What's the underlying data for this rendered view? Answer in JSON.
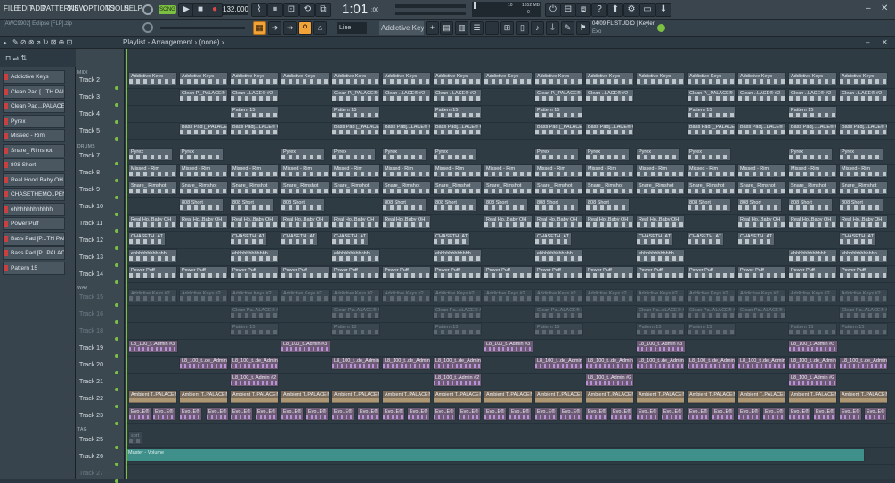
{
  "menu": [
    "FILE",
    "EDIT",
    "ADD",
    "PATTERNS",
    "VIEW",
    "OPTIONS",
    "TOOLS",
    "HELP"
  ],
  "transport": {
    "mode": "SONG",
    "tempo": "132.000",
    "time": "1:01",
    "time_sub": ":00",
    "cpu": "10",
    "mem": "1652 MB",
    "mem2": "0"
  },
  "hint": {
    "project": "[AWC9902] Eclipse [FLP].zip",
    "line": "04/09  FL STUDIO | Keyler",
    "sub": "Exo"
  },
  "toolbar": {
    "snap": "Line",
    "pattern": "Addictive Keys"
  },
  "playlist": {
    "title": "Playlist - Arrangement",
    "sub": "(none)"
  },
  "browser_patterns": [
    "Addictive Keys",
    "Clean Pad [...TH PALACE®",
    "Clean Pad...PALACE® #2",
    "Pyrex",
    "Missed - Rim",
    "Snare_ Rimshot",
    "808 Short",
    "Real Hood Baby OH",
    "CHASETHEMO..PEN HAT 1",
    "ehhhhhhhhhhhh",
    "Power Puff",
    "Bass Pad [P...TH PALACE®",
    "Bass Pad [P...PALACE® #2",
    "Pattern 15"
  ],
  "sections": {
    "midi": "MIDI",
    "drums": "DRUMS",
    "wav": "WAV",
    "fx": "FX",
    "tag": "TAG"
  },
  "tracks": [
    "Track 2",
    "Track 3",
    "Track 4",
    "Track 5",
    "Track 7",
    "Track 8",
    "Track 9",
    "Track 10",
    "Track 11",
    "Track 12",
    "Track 13",
    "Track 14",
    "Track 15",
    "Track 16",
    "Track 18",
    "Track 19",
    "Track 20",
    "Track 21",
    "Track 22",
    "Track 23",
    "Track 25",
    "Track 26",
    "Track 27"
  ],
  "ruler": [
    "3",
    "5",
    "9",
    "13",
    "17",
    "21",
    "25",
    "29",
    "33",
    "37",
    "41",
    "45",
    "49",
    "53",
    "57",
    "61",
    "65",
    "69",
    "73",
    "77",
    "81",
    "85",
    "89",
    "93",
    "97",
    "101",
    "105",
    "109",
    "113",
    "117"
  ],
  "clip_labels": {
    "t2": "Addictive Keys",
    "t3a": "Clean P._PALACE®",
    "t3b": "Clean ..LACE® #2",
    "t4": "Pattern 15",
    "t5a": "Bass Pad [_PALACE®",
    "t5b": "Bass Pad[...LACE® #2",
    "t7": "Pyrex",
    "t8": "Missed - Rim",
    "t9": "Snare_ Rimshot",
    "t10": "808 Short",
    "t11": "Real Ho..Baby OH",
    "t12": "CHASETH..AT 1",
    "t13": "ehhhhhhhhhhhh",
    "t14": "Power Puff",
    "t15": "Addictive Keys #2",
    "t16": "Clean Pa..ALACE® #2",
    "t18": "Pattern 15",
    "t19": "L8_100_t..Admin #3",
    "t20": "L8_100_t..de_Admin",
    "t21": "L8_100_t..Admin #2",
    "t22": "Ambient T..PALACE®",
    "t23": "Evo..E®",
    "t25": "sort",
    "t26": "Master - Volume"
  },
  "colors": {
    "accent": "#f1a33a",
    "clip": "#5a6770",
    "audio": "#6d5a74",
    "automation": "#3f8f8a"
  }
}
